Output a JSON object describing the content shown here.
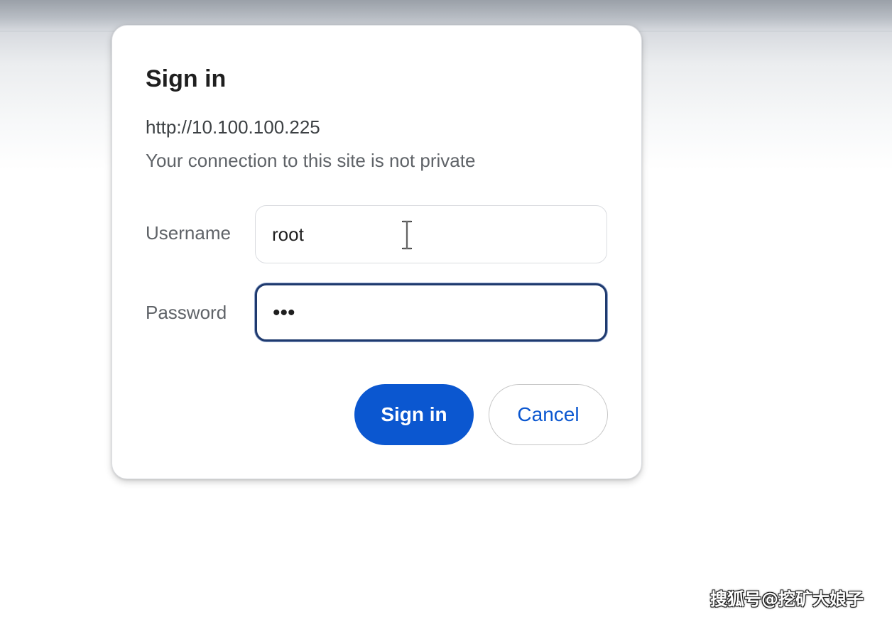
{
  "dialog": {
    "title": "Sign in",
    "url": "http://10.100.100.225",
    "warning": "Your connection to this site is not private",
    "username_label": "Username",
    "username_value": "root",
    "password_label": "Password",
    "password_masked": "•••",
    "signin_label": "Sign in",
    "cancel_label": "Cancel"
  },
  "watermark": {
    "text": "搜狐号@挖矿大娘子"
  },
  "colors": {
    "primary": "#0b57d0",
    "focus_border": "#1f3a6e",
    "title_text": "#1f1f1f",
    "secondary_text": "#5f6368"
  },
  "icons": {
    "cursor": "text-cursor-icon"
  }
}
